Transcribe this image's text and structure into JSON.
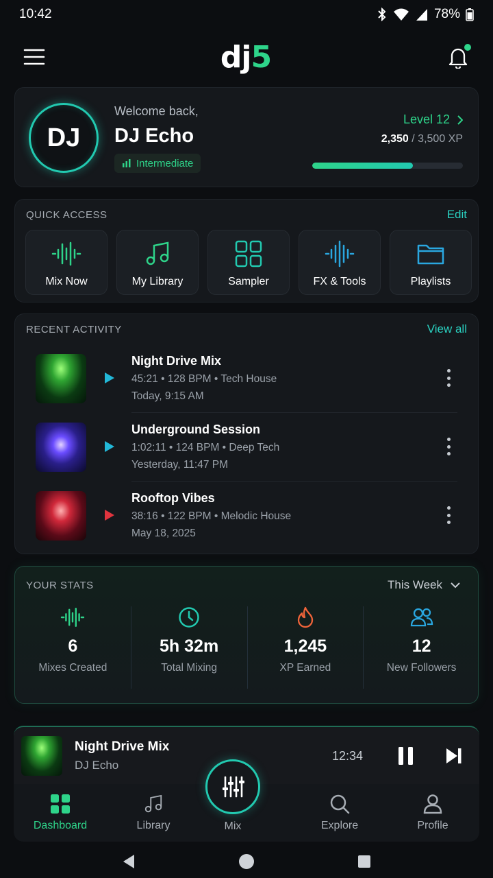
{
  "status": {
    "time": "10:42",
    "battery": "78%"
  },
  "app": {
    "logo_main": "dj",
    "logo_accent": "5"
  },
  "profile": {
    "avatar_initials": "DJ",
    "welcome": "Welcome back,",
    "name": "DJ Echo",
    "badge": "Intermediate",
    "level": "Level 12",
    "xp_current": "2,350",
    "xp_total": "/ 3,500 XP",
    "xp_progress": 0.67
  },
  "quick_access": {
    "title": "QUICK ACCESS",
    "edit": "Edit",
    "items": [
      {
        "label": "Mix Now",
        "icon": "waveform-icon"
      },
      {
        "label": "My Library",
        "icon": "music-note-icon"
      },
      {
        "label": "Sampler",
        "icon": "grid-icon"
      },
      {
        "label": "FX & Tools",
        "icon": "fx-waveform-icon"
      },
      {
        "label": "Playlists",
        "icon": "folder-icon"
      }
    ]
  },
  "recent": {
    "title": "RECENT ACTIVITY",
    "view_all": "View all",
    "items": [
      {
        "title": "Night Drive Mix",
        "meta": "45:21 • 128 BPM • Tech House",
        "date": "Today, 9:15 AM",
        "play_color": "#22b8d8"
      },
      {
        "title": "Underground Session",
        "meta": "1:02:11 • 124 BPM • Deep Tech",
        "date": "Yesterday, 11:47 PM",
        "play_color": "#22b8d8"
      },
      {
        "title": "Rooftop Vibes",
        "meta": "38:16 • 122 BPM • Melodic House",
        "date": "May 18, 2025",
        "play_color": "#e0343e"
      }
    ]
  },
  "stats": {
    "title": "YOUR STATS",
    "period": "This Week",
    "items": [
      {
        "value": "6",
        "label": "Mixes Created"
      },
      {
        "value": "5h 32m",
        "label": "Total Mixing"
      },
      {
        "value": "1,245",
        "label": "XP Earned"
      },
      {
        "value": "12",
        "label": "New Followers"
      }
    ]
  },
  "player": {
    "title": "Night Drive Mix",
    "artist": "DJ Echo",
    "time": "12:34"
  },
  "nav": {
    "dashboard": "Dashboard",
    "library": "Library",
    "mix": "Mix",
    "explore": "Explore",
    "profile": "Profile"
  },
  "colors": {
    "accent": "#2ed48a",
    "teal": "#22c9b0",
    "link": "#2ad0c0"
  }
}
